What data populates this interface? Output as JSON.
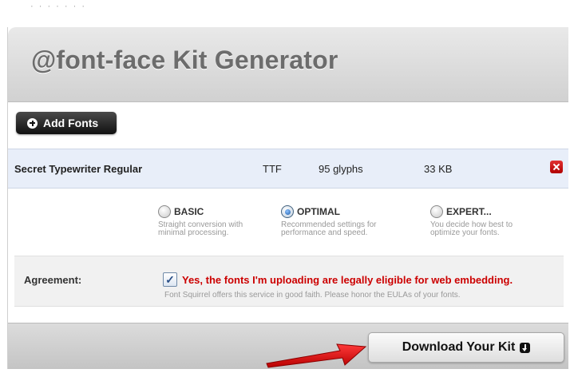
{
  "header": {
    "title": "@font-face Kit Generator"
  },
  "toolbar": {
    "add_fonts_label": "Add Fonts"
  },
  "font_row": {
    "name": "Secret Typewriter Regular",
    "format": "TTF",
    "glyphs": "95 glyphs",
    "size": "33 KB"
  },
  "options": [
    {
      "label": "BASIC",
      "description_line1": "Straight conversion with",
      "description_line2": "minimal processing.",
      "selected": false
    },
    {
      "label": "OPTIMAL",
      "description_line1": "Recommended settings for",
      "description_line2": "performance and speed.",
      "selected": true
    },
    {
      "label": "EXPERT...",
      "description_line1": "You decide how best to",
      "description_line2": "optimize your fonts.",
      "selected": false
    }
  ],
  "agreement": {
    "label": "Agreement:",
    "checked": true,
    "text": "Yes, the fonts I'm uploading are legally eligible for web embedding.",
    "note": "Font Squirrel offers this service in good faith. Please honor the EULAs of your fonts."
  },
  "footer": {
    "download_label": "Download Your Kit"
  },
  "colors": {
    "agreement_text": "#cc0000",
    "arrow": "#e01010",
    "font_row_bg": "#e8eef9",
    "remove_icon": "#cc0000"
  }
}
